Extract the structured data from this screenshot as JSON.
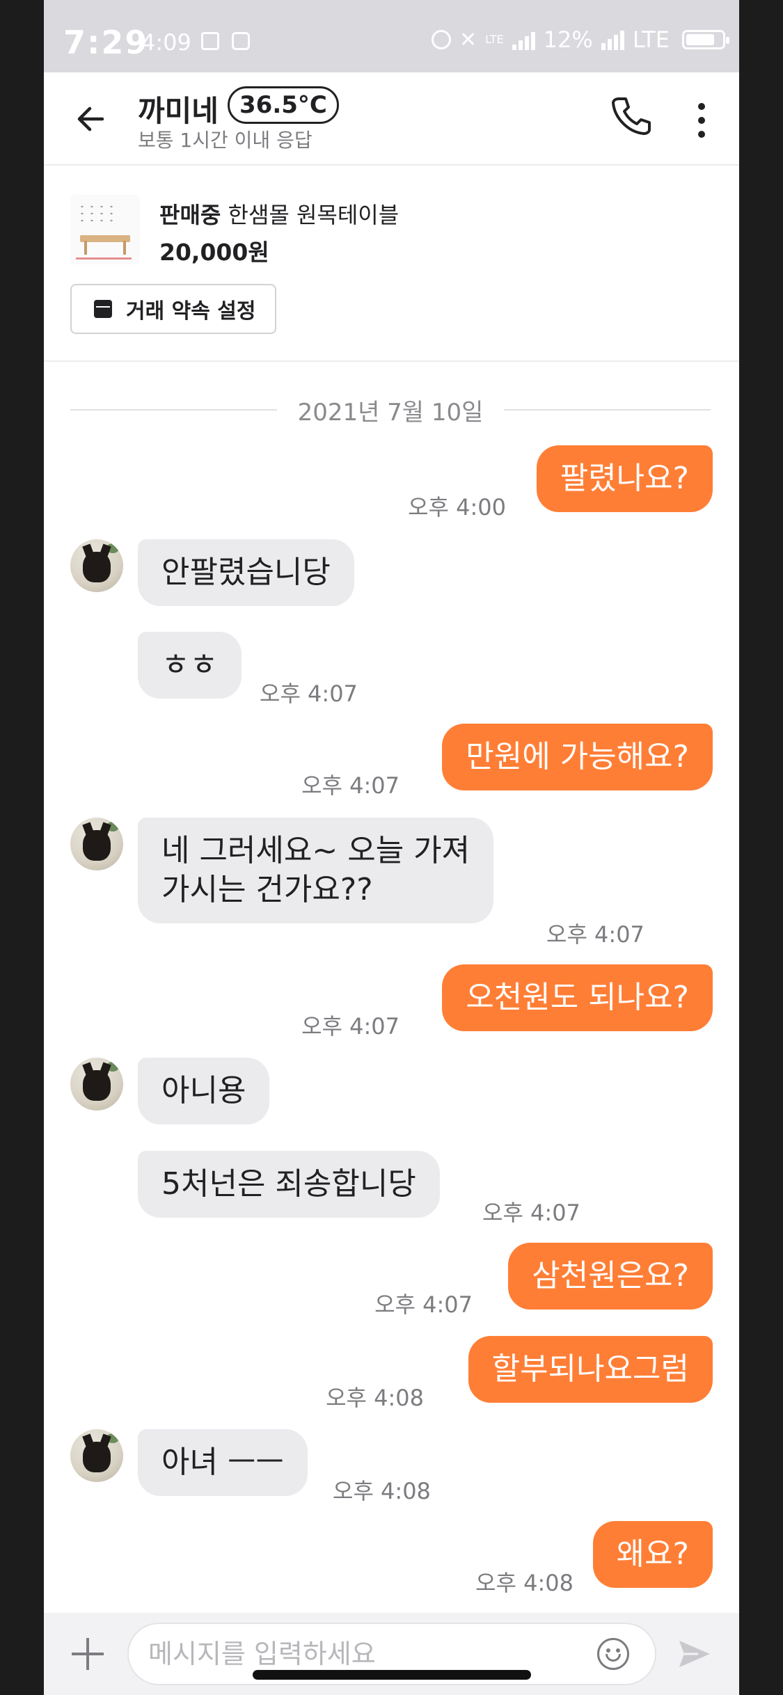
{
  "status_bar": {
    "time_overlay": "7:29",
    "time": "4:09",
    "battery_pct": "12%",
    "network_small": "LTE",
    "network": "LTE"
  },
  "header": {
    "name": "까미네",
    "temperature": "36.5°C",
    "response_info": "보통 1시간 이내 응답"
  },
  "product": {
    "status": "판매중",
    "title": "한샘몰 원목테이블",
    "price": "20,000원",
    "deal_button": "거래 약속 설정"
  },
  "chat": {
    "date": "2021년 7월 10일",
    "messages": [
      {
        "from": "me",
        "text": "팔렸나요?",
        "time": "오후 4:00"
      },
      {
        "from": "them",
        "text": "안팔렸습니당"
      },
      {
        "from": "them",
        "text": "ㅎㅎ",
        "time": "오후 4:07"
      },
      {
        "from": "me",
        "text": "만원에 가능해요?",
        "time": "오후 4:07"
      },
      {
        "from": "them",
        "line1": "네 그러세요~ 오늘 가져",
        "line2": "가시는 건가요??",
        "time": "오후 4:07"
      },
      {
        "from": "me",
        "text": "오천원도 되나요?",
        "time": "오후 4:07"
      },
      {
        "from": "them",
        "text": "아니용"
      },
      {
        "from": "them",
        "text": "5처넌은 죄송합니당",
        "time": "오후 4:07"
      },
      {
        "from": "me",
        "text": "삼천원은요?",
        "time": "오후 4:07"
      },
      {
        "from": "me",
        "text": "할부되나요그럼",
        "time": "오후 4:08"
      },
      {
        "from": "them",
        "text": "아녀 ㅡㅡ",
        "time": "오후 4:08"
      },
      {
        "from": "me",
        "text": "왜요?",
        "time": "오후 4:08"
      }
    ]
  },
  "input": {
    "placeholder": "메시지를 입력하세요"
  },
  "colors": {
    "accent": "#ff7e36",
    "their_bubble": "#ebebee",
    "text": "#212124",
    "muted": "#7c7c80"
  },
  "icons": [
    "back-arrow-icon",
    "phone-icon",
    "more-vertical-icon",
    "calendar-icon",
    "plus-icon",
    "emoji-icon",
    "send-icon"
  ]
}
